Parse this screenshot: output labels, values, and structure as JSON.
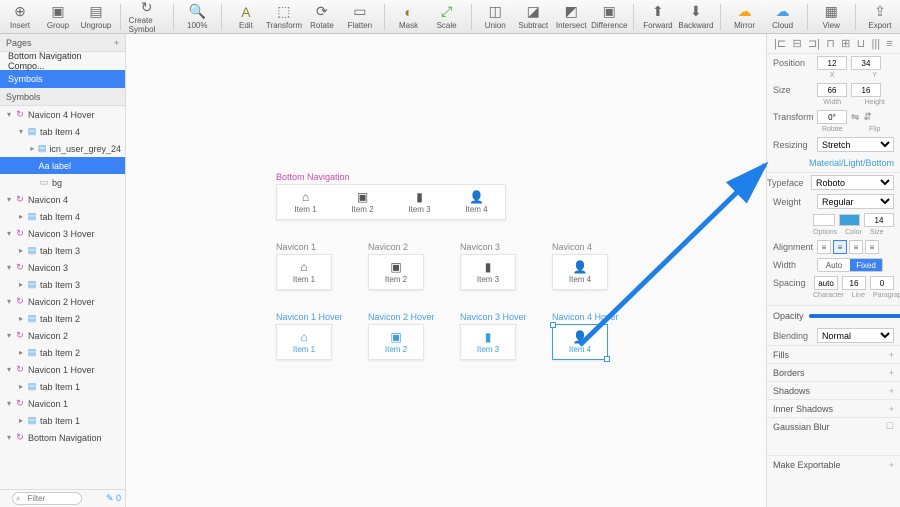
{
  "toolbar": [
    {
      "label": "Insert",
      "icon": "⊕"
    },
    {
      "label": "Group",
      "icon": "▣"
    },
    {
      "label": "Ungroup",
      "icon": "▤"
    },
    {
      "sep": true
    },
    {
      "label": "Create Symbol",
      "icon": "↻"
    },
    {
      "sep": true
    },
    {
      "label": "100%",
      "icon": "🔍",
      "zoom": true
    },
    {
      "sep": true
    },
    {
      "label": "Edit",
      "icon": "A",
      "cls": "edit"
    },
    {
      "label": "Transform",
      "icon": "⬚"
    },
    {
      "label": "Rotate",
      "icon": "⟳"
    },
    {
      "label": "Flatten",
      "icon": "▭"
    },
    {
      "sep": true
    },
    {
      "label": "Mask",
      "icon": "◐",
      "cls": "mask"
    },
    {
      "label": "Scale",
      "icon": "⤢",
      "cls": "scale"
    },
    {
      "sep": true
    },
    {
      "label": "Union",
      "icon": "◫"
    },
    {
      "label": "Subtract",
      "icon": "◪"
    },
    {
      "label": "Intersect",
      "icon": "◩"
    },
    {
      "label": "Difference",
      "icon": "▣"
    },
    {
      "sep": true
    },
    {
      "label": "Forward",
      "icon": "⬆"
    },
    {
      "label": "Backward",
      "icon": "⬇"
    },
    {
      "sep": true
    },
    {
      "label": "Mirror",
      "icon": "☁",
      "cls": "cloud"
    },
    {
      "label": "Cloud",
      "icon": "☁",
      "cls": "cloud2"
    },
    {
      "sep": true
    },
    {
      "label": "View",
      "icon": "▦"
    },
    {
      "sep": true
    },
    {
      "label": "Export",
      "icon": "⇪"
    }
  ],
  "pages": {
    "title": "Pages",
    "items": [
      "Bottom Navigation Compo...",
      "Symbols"
    ],
    "selected": 1
  },
  "symbols_title": "Symbols",
  "layers": [
    {
      "d": 0,
      "i": "↻",
      "c": "purple",
      "t": "Navicon 4 Hover",
      "open": true
    },
    {
      "d": 1,
      "i": "▤",
      "c": "blue",
      "t": "tab Item 4",
      "open": true
    },
    {
      "d": 2,
      "i": "▤",
      "c": "blue",
      "t": "icn_user_grey_24",
      "open": false
    },
    {
      "d": 2,
      "i": "Aa",
      "c": "grey",
      "t": "label",
      "sel": true
    },
    {
      "d": 2,
      "i": "▭",
      "c": "grey",
      "t": "bg"
    },
    {
      "d": 0,
      "i": "↻",
      "c": "purple",
      "t": "Navicon 4",
      "open": true
    },
    {
      "d": 1,
      "i": "▤",
      "c": "blue",
      "t": "tab Item 4",
      "open": false
    },
    {
      "d": 0,
      "i": "↻",
      "c": "purple",
      "t": "Navicon 3 Hover",
      "open": true
    },
    {
      "d": 1,
      "i": "▤",
      "c": "blue",
      "t": "tab Item 3",
      "open": false
    },
    {
      "d": 0,
      "i": "↻",
      "c": "purple",
      "t": "Navicon 3",
      "open": true
    },
    {
      "d": 1,
      "i": "▤",
      "c": "blue",
      "t": "tab Item 3",
      "open": false
    },
    {
      "d": 0,
      "i": "↻",
      "c": "purple",
      "t": "Navicon 2 Hover",
      "open": true
    },
    {
      "d": 1,
      "i": "▤",
      "c": "blue",
      "t": "tab Item 2",
      "open": false
    },
    {
      "d": 0,
      "i": "↻",
      "c": "purple",
      "t": "Navicon 2",
      "open": true
    },
    {
      "d": 1,
      "i": "▤",
      "c": "blue",
      "t": "tab Item 2",
      "open": false
    },
    {
      "d": 0,
      "i": "↻",
      "c": "purple",
      "t": "Navicon 1 Hover",
      "open": true
    },
    {
      "d": 1,
      "i": "▤",
      "c": "blue",
      "t": "tab Item 1",
      "open": false
    },
    {
      "d": 0,
      "i": "↻",
      "c": "purple",
      "t": "Navicon 1",
      "open": true
    },
    {
      "d": 1,
      "i": "▤",
      "c": "blue",
      "t": "tab Item 1",
      "open": false
    },
    {
      "d": 0,
      "i": "↻",
      "c": "purple",
      "t": "Bottom Navigation",
      "open": true
    }
  ],
  "filter": {
    "placeholder": "Filter",
    "badge": "0"
  },
  "canvas": {
    "bottom_nav": {
      "title": "Bottom Navigation",
      "items": [
        "Item 1",
        "Item 2",
        "Item 3",
        "Item 4"
      ],
      "icons": [
        "⌂",
        "▣",
        "▮",
        "👤"
      ]
    },
    "navicons": [
      {
        "title": "Navicon 1",
        "icon": "⌂",
        "label": "Item 1"
      },
      {
        "title": "Navicon 2",
        "icon": "▣",
        "label": "Item 2"
      },
      {
        "title": "Navicon 3",
        "icon": "▮",
        "label": "Item 3"
      },
      {
        "title": "Navicon 4",
        "icon": "👤",
        "label": "Item 4"
      }
    ],
    "hovers": [
      {
        "title": "Navicon 1 Hover",
        "icon": "⌂",
        "label": "Item 1"
      },
      {
        "title": "Navicon 2 Hover",
        "icon": "▣",
        "label": "Item 2"
      },
      {
        "title": "Navicon 3 Hover",
        "icon": "▮",
        "label": "Item 3"
      },
      {
        "title": "Navicon 4 Hover",
        "icon": "👤",
        "label": "Item 4"
      }
    ]
  },
  "inspector": {
    "position": {
      "label": "Position",
      "x": "12",
      "y": "34",
      "xl": "X",
      "yl": "Y"
    },
    "size": {
      "label": "Size",
      "w": "66",
      "h": "16",
      "wl": "Width",
      "hl": "Height"
    },
    "transform": {
      "label": "Transform",
      "v": "0°",
      "rl": "Rotate",
      "fl": "Flip"
    },
    "resizing": {
      "label": "Resizing",
      "v": "Stretch"
    },
    "symbol_path": "Material/Light/Bottom",
    "typeface": {
      "label": "Typeface",
      "v": "Roboto"
    },
    "weight": {
      "label": "Weight",
      "v": "Regular",
      "size": "14"
    },
    "opts": [
      "Options",
      "Color",
      "Size"
    ],
    "alignment": {
      "label": "Alignment"
    },
    "width": {
      "label": "Width",
      "auto": "Auto",
      "fixed": "Fixed"
    },
    "spacing": {
      "label": "Spacing",
      "a": "auto",
      "b": "16",
      "c": "0",
      "la": "Character",
      "lb": "Line",
      "lc": "Paragraph"
    },
    "opacity": {
      "label": "Opacity",
      "v": "100%"
    },
    "blending": {
      "label": "Blending",
      "v": "Normal"
    },
    "sections": [
      "Fills",
      "Borders",
      "Shadows",
      "Inner Shadows",
      "Gaussian Blur"
    ],
    "export": "Make Exportable"
  }
}
